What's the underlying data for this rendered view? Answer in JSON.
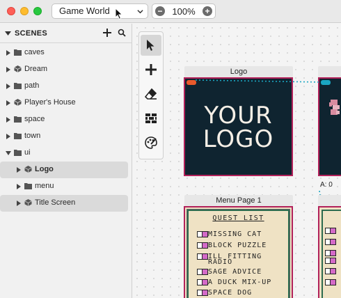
{
  "window": {
    "project_name": "Game World",
    "zoom": "100%",
    "zoom_minus": "−",
    "zoom_plus": "+"
  },
  "sidebar": {
    "header": "SCENES",
    "items": [
      {
        "label": "caves",
        "icon": "folder-icon",
        "expanded": false
      },
      {
        "label": "Dream",
        "icon": "scene-icon",
        "expanded": false
      },
      {
        "label": "path",
        "icon": "folder-icon",
        "expanded": false
      },
      {
        "label": "Player's House",
        "icon": "scene-icon",
        "expanded": false
      },
      {
        "label": "space",
        "icon": "folder-icon",
        "expanded": false
      },
      {
        "label": "town",
        "icon": "folder-icon",
        "expanded": false
      },
      {
        "label": "ui",
        "icon": "folder-icon",
        "expanded": true
      },
      {
        "label": "Logo",
        "icon": "scene-icon",
        "expanded": false,
        "selected": true
      },
      {
        "label": "menu",
        "icon": "folder-icon",
        "expanded": false
      },
      {
        "label": "Title Screen",
        "icon": "scene-icon",
        "expanded": false,
        "highlighted": true
      }
    ]
  },
  "tools": [
    "select-tool",
    "add-tool",
    "eraser-tool",
    "collision-tool",
    "paint-tool"
  ],
  "canvas": {
    "logo_scene": {
      "name": "Logo",
      "line1": "YOUR",
      "line2": "LOGO"
    },
    "menu_scene": {
      "name": "Menu Page 1",
      "title": "QUEST LIST",
      "items": [
        "MISSING CAT",
        "BLOCK PUZZLE",
        "ILL FITTING",
        "RADIO",
        "SAGE ADVICE",
        "A DUCK MIX-UP",
        "SPACE DOG"
      ]
    },
    "partial_label": "A: 0"
  },
  "colors": {
    "frame_border": "#b2215a",
    "logo_bg": "#0f2430",
    "accent_teal": "#1aa6c2",
    "menu_bg": "#efe2c4",
    "checkbox_pink": "#d46ac8"
  }
}
